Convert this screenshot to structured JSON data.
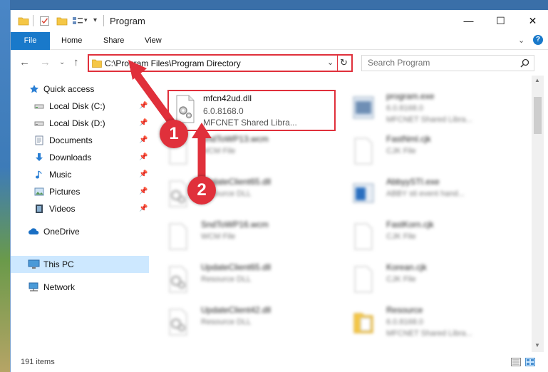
{
  "window": {
    "title": "Program",
    "controls": [
      "minimize",
      "maximize",
      "close"
    ]
  },
  "ribbon": {
    "tabs": [
      "File",
      "Home",
      "Share",
      "View"
    ]
  },
  "address": {
    "path": "C:\\Program Files\\Program Directory",
    "search_placeholder": "Search Program"
  },
  "sidebar": {
    "items": [
      {
        "label": "Quick access",
        "icon": "star-icon"
      },
      {
        "label": "Local Disk (C:)",
        "icon": "drive-icon"
      },
      {
        "label": "Local Disk (D:)",
        "icon": "drive-icon"
      },
      {
        "label": "Documents",
        "icon": "documents-icon"
      },
      {
        "label": "Downloads",
        "icon": "download-icon"
      },
      {
        "label": "Music",
        "icon": "music-icon"
      },
      {
        "label": "Pictures",
        "icon": "pictures-icon"
      },
      {
        "label": "Videos",
        "icon": "videos-icon"
      },
      {
        "label": "OneDrive",
        "icon": "cloud-icon"
      },
      {
        "label": "This PC",
        "icon": "computer-icon"
      },
      {
        "label": "Network",
        "icon": "network-icon"
      }
    ]
  },
  "files": {
    "highlighted": {
      "name": "mfcn42ud.dll",
      "line2": "6.0.8168.0",
      "line3": "MFCNET Shared Libra..."
    },
    "others": [
      {
        "name": "program.exe",
        "line2": "6.0.8168.0",
        "line3": "MFCNET Shared Libra..."
      },
      {
        "name": "SndToWP13.wcm",
        "line2": "WCM File",
        "line3": ""
      },
      {
        "name": "FastNml.cjk",
        "line2": "CJK File",
        "line3": ""
      },
      {
        "name": "UpdateClient65.dll",
        "line2": "Resource DLL",
        "line3": ""
      },
      {
        "name": "AbbyySTI.exe",
        "line2": "ABBY sti event hand...",
        "line3": ""
      },
      {
        "name": "SndToWP16.wcm",
        "line2": "WCM File",
        "line3": ""
      },
      {
        "name": "FastKorn.cjk",
        "line2": "CJK File",
        "line3": ""
      },
      {
        "name": "UpdateClient65.dll",
        "line2": "Resource DLL",
        "line3": ""
      },
      {
        "name": "Korean.cjk",
        "line2": "CJK File",
        "line3": ""
      },
      {
        "name": "UpdateClient42.dll",
        "line2": "Resource DLL",
        "line3": ""
      },
      {
        "name": "Resource",
        "line2": "6.0.8168.0",
        "line3": "MFCNET Shared Libra..."
      }
    ]
  },
  "status": {
    "item_count": "191 items"
  },
  "annotations": {
    "step1": "1",
    "step2": "2"
  },
  "colors": {
    "accent": "#1979ca",
    "highlight": "#e0303b",
    "selected": "#cde8ff"
  }
}
